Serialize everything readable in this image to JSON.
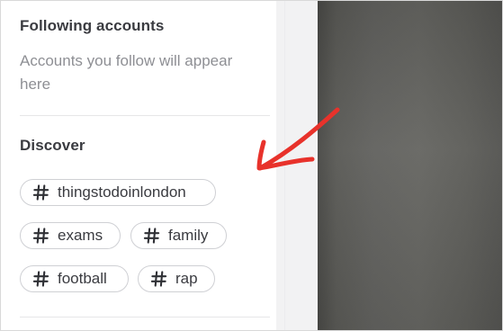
{
  "following": {
    "title": "Following accounts",
    "description": "Accounts you follow will appear here"
  },
  "discover": {
    "title": "Discover",
    "tags": [
      {
        "label": "thingstodoinlondon",
        "icon": "hashtag-icon"
      },
      {
        "label": "exams",
        "icon": "hashtag-icon"
      },
      {
        "label": "family",
        "icon": "hashtag-icon"
      },
      {
        "label": "football",
        "icon": "hashtag-icon"
      },
      {
        "label": "rap",
        "icon": "hashtag-icon"
      }
    ]
  },
  "annotation": {
    "arrow_color": "#e8322b",
    "arrow_icon": "red-arrow-annotation"
  },
  "colors": {
    "heading": "#3a3b40",
    "muted_text": "#8e8f94",
    "tag_border": "#cfd0d4",
    "video_background": "#636360"
  }
}
